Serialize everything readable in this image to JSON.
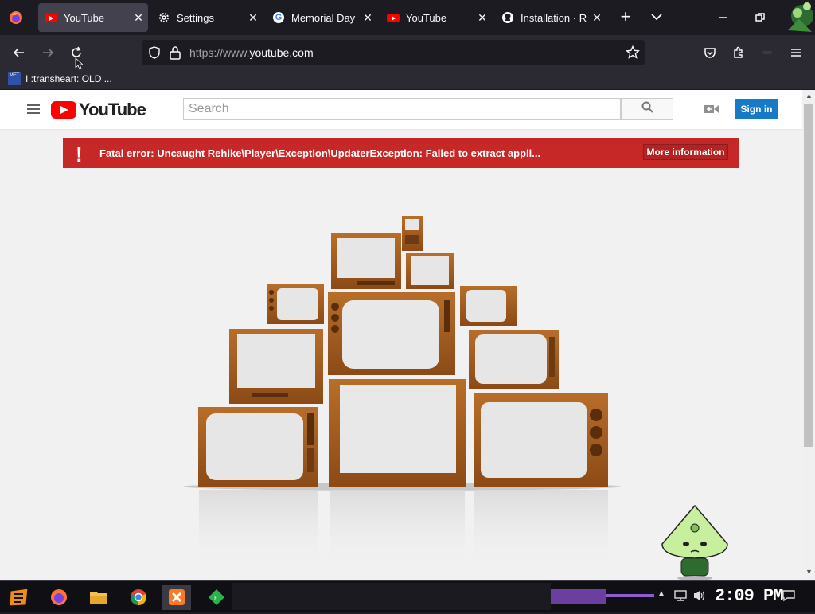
{
  "browser": {
    "tabs": [
      {
        "title": "YouTube",
        "favicon": "youtube-icon",
        "active": true
      },
      {
        "title": "Settings",
        "favicon": "gear-icon",
        "active": false
      },
      {
        "title": "Memorial Day -",
        "favicon": "google-icon",
        "active": false
      },
      {
        "title": "YouTube",
        "favicon": "youtube-icon",
        "active": false
      },
      {
        "title": "Installation · Re",
        "favicon": "github-icon",
        "active": false
      }
    ],
    "close_glyph": "✕",
    "new_tab_glyph": "+",
    "url": {
      "scheme": "https://www.",
      "host": "youtube.com"
    },
    "bookmarks": [
      {
        "label": "I :transheart: OLD ...",
        "icon_text": "MFT"
      }
    ]
  },
  "youtube": {
    "logo_text": "YouTube",
    "search_placeholder": "Search",
    "signin_label": "Sign in",
    "error": {
      "icon": "!",
      "message": "Fatal error: Uncaught Rehike\\Player\\Exception\\UpdaterException: Failed to extract appli...",
      "button_label": "More information"
    }
  },
  "taskbar": {
    "clock": "2:09 PM",
    "apps": [
      "start-icon",
      "firefox-icon",
      "file-explorer-icon",
      "chrome-icon",
      "xampp-icon",
      "feedly-icon"
    ]
  },
  "colors": {
    "tab_bg": "#1c1b22",
    "toolbar_bg": "#2b2a33",
    "error_red": "#c62828",
    "signin_blue": "#167ac6",
    "yt_red": "#ff0000"
  }
}
